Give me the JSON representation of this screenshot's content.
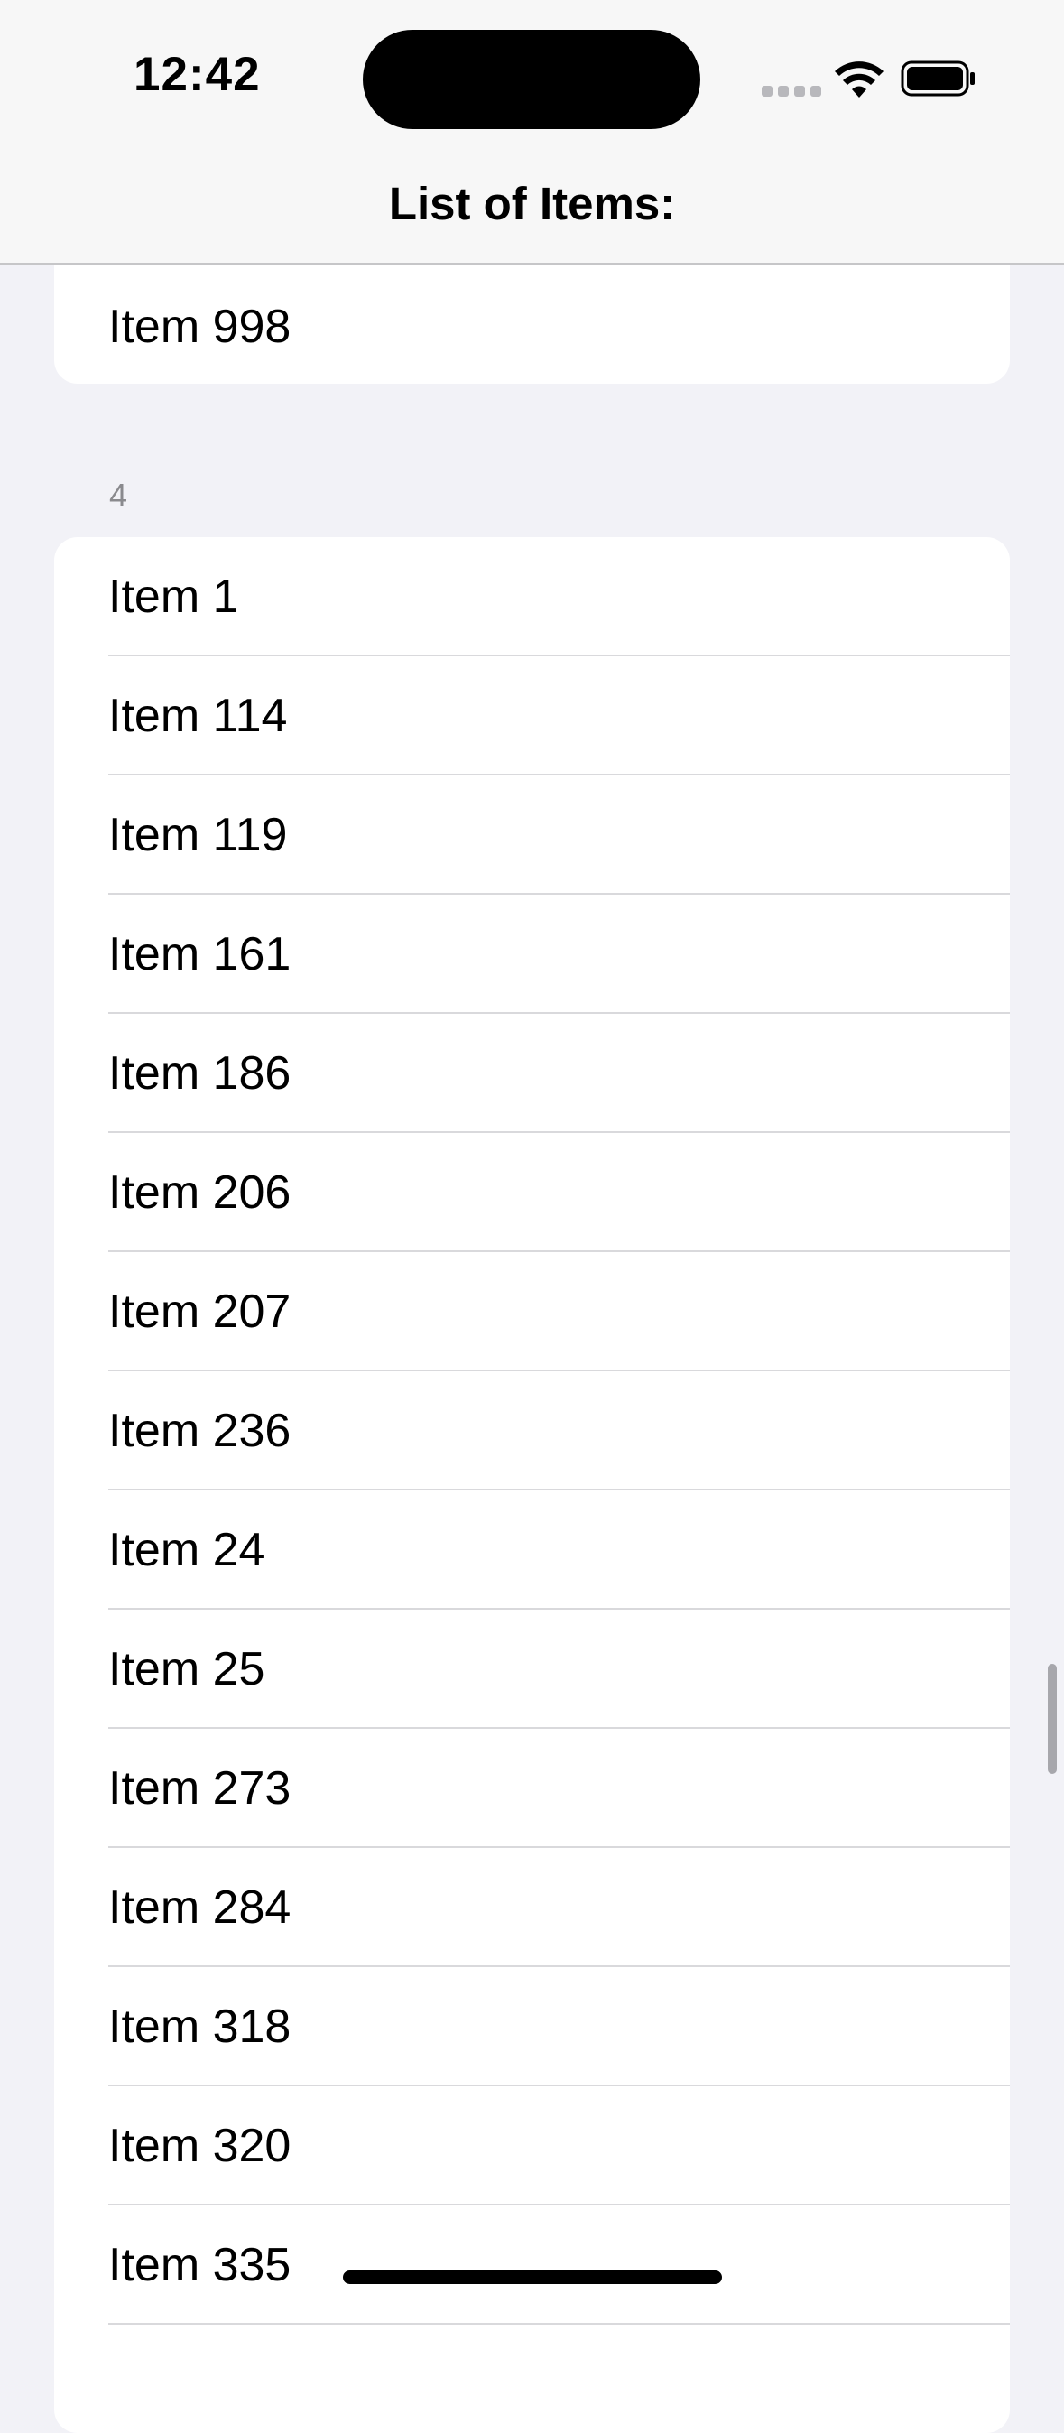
{
  "status_bar": {
    "time": "12:42"
  },
  "nav": {
    "title": "List of Items:"
  },
  "top_section": {
    "items": [
      {
        "label": "Item 998"
      }
    ]
  },
  "section": {
    "header": "4",
    "items": [
      {
        "label": "Item 1"
      },
      {
        "label": "Item 114"
      },
      {
        "label": "Item 119"
      },
      {
        "label": "Item 161"
      },
      {
        "label": "Item 186"
      },
      {
        "label": "Item 206"
      },
      {
        "label": "Item 207"
      },
      {
        "label": "Item 236"
      },
      {
        "label": "Item 24"
      },
      {
        "label": "Item 25"
      },
      {
        "label": "Item 273"
      },
      {
        "label": "Item 284"
      },
      {
        "label": "Item 318"
      },
      {
        "label": "Item 320"
      },
      {
        "label": "Item 335"
      }
    ]
  },
  "icons": {
    "wifi": "wifi-icon",
    "battery": "battery-icon",
    "signal": "cellular-signal-icon"
  },
  "colors": {
    "background": "#f2f2f7",
    "card": "#ffffff",
    "separator": "#d9d9dc",
    "section_header": "#8a8a8e"
  }
}
